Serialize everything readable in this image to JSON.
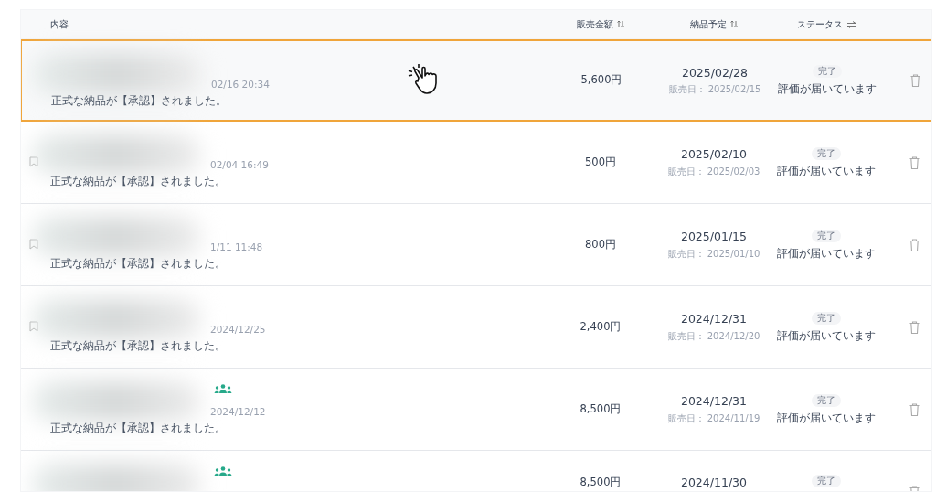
{
  "table": {
    "columns": [
      {
        "label": "内容"
      },
      {
        "label": "販売金額"
      },
      {
        "label": "納品予定"
      },
      {
        "label": "ステータス"
      }
    ],
    "rows": [
      {
        "selected": true,
        "bookmark": false,
        "group": false,
        "time": "02/16 20:34",
        "note": "正式な納品が【承認】されました。",
        "amount": "5,600円",
        "delivery": "2025/02/28",
        "sale_date": "販売日： 2025/02/15",
        "badge": "完了",
        "status": "評価が届いています",
        "cursor": true
      },
      {
        "selected": false,
        "bookmark": true,
        "group": false,
        "time": "02/04 16:49",
        "note": "正式な納品が【承認】されました。",
        "amount": "500円",
        "delivery": "2025/02/10",
        "sale_date": "販売日： 2025/02/03",
        "badge": "完了",
        "status": "評価が届いています",
        "cursor": false
      },
      {
        "selected": false,
        "bookmark": true,
        "group": false,
        "time": "1/11 11:48",
        "note": "正式な納品が【承認】されました。",
        "amount": "800円",
        "delivery": "2025/01/15",
        "sale_date": "販売日： 2025/01/10",
        "badge": "完了",
        "status": "評価が届いています",
        "cursor": false
      },
      {
        "selected": false,
        "bookmark": true,
        "group": false,
        "time": "2024/12/25",
        "note": "正式な納品が【承認】されました。",
        "amount": "2,400円",
        "delivery": "2024/12/31",
        "sale_date": "販売日： 2024/12/20",
        "badge": "完了",
        "status": "評価が届いています",
        "cursor": false
      },
      {
        "selected": false,
        "bookmark": false,
        "group": true,
        "time": "2024/12/12",
        "note": "正式な納品が【承認】されました。",
        "amount": "8,500円",
        "delivery": "2024/12/31",
        "sale_date": "販売日： 2024/11/19",
        "badge": "完了",
        "status": "評価が届いています",
        "cursor": false
      },
      {
        "selected": false,
        "bookmark": false,
        "group": true,
        "amount": "8,500円",
        "delivery": "2024/11/30",
        "badge": "完了",
        "cursor": false
      }
    ]
  }
}
